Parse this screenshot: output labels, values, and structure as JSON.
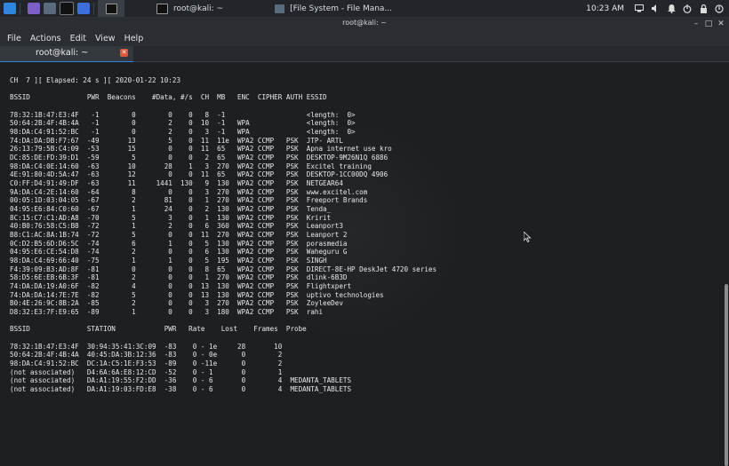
{
  "taskbar": {
    "tasks": [
      {
        "label": "root@kali: ~"
      },
      {
        "label": "[File System - File Mana..."
      }
    ],
    "clock": "10:23 AM"
  },
  "window": {
    "title": "root@kali: ~",
    "controls": [
      "–",
      "□",
      "✕"
    ]
  },
  "menu": [
    "File",
    "Actions",
    "Edit",
    "View",
    "Help"
  ],
  "tab": {
    "label": "root@kali: ~"
  },
  "terminal": {
    "lines": [
      "CH  7 ][ Elapsed: 24 s ][ 2020-01-22 10:23",
      "",
      "BSSID              PWR  Beacons    #Data, #/s  CH  MB   ENC  CIPHER AUTH ESSID",
      "",
      "78:32:1B:47:E3:4F   -1        0        0    0   8  -1                    <length:  0>",
      "50:64:2B:4F:4B:4A   -1        0        2    0  10  -1   WPA              <length:  0>",
      "98:DA:C4:91:52:BC   -1        0        2    0   3  -1   WPA              <length:  0>",
      "74:DA:DA:DB:F7:67  -49       13        5    0  11  11e  WPA2 CCMP   PSK  JTP- ARTL",
      "26:13:79:5B:C4:09  -53       15        0    0  11  65   WPA2 CCMP   PSK  Apna internet use kro",
      "DC:85:DE:FD:39:D1  -59        5        0    0   2  65   WPA2 CCMP   PSK  DESKTOP-9M26N1Q 6886",
      "98:DA:C4:0E:14:60  -63       10       28    1   3  270  WPA2 CCMP   PSK  Excitel training",
      "4E:91:80:4D:5A:47  -63       12        0    0  11  65   WPA2 CCMP   PSK  DESKTOP-1CC00DQ 4906",
      "C0:FF:D4:91:49:DF  -63       11     1441  130   9  130  WPA2 CCMP   PSK  NETGEAR64",
      "9A:DA:C4:2E:14:60  -64        8        0    0   3  270  WPA2 CCMP   PSK  www.excitel.com",
      "00:05:1D:03:04:05  -67        2       81    0   1  270  WPA2 CCMP   PSK  Freeport Brands",
      "04:95:E6:84:C0:60  -67        1       24    0   2  130  WPA2 CCMP   PSK  Tenda_",
      "8C:15:C7:C1:AD:A8  -70        5        3    0   1  130  WPA2 CCMP   PSK  Kririt",
      "40:B0:76:58:C5:B8  -72        1        2    0   6  360  WPA2 CCMP   PSK  Leanport3",
      "B8:C1:AC:8A:1B:74  -72        5        0    0  11  270  WPA2 CCMP   PSK  Leanport 2",
      "0C:D2:B5:6D:D6:5C  -74        6        1    0   5  130  WPA2 CCMP   PSK  porasmedia",
      "04:95:E6:CE:54:D8  -74        2        0    0   6  130  WPA2 CCMP   PSK  Waheguru G",
      "98:DA:C4:69:66:40  -75        1        1    0   5  195  WPA2 CCMP   PSK  SINGH",
      "F4:39:09:B3:AD:8F  -81        0        0    0   8  65   WPA2 CCMP   PSK  DIRECT-8E-HP DeskJet 4720 series",
      "58:D5:6E:EB:6B:3F  -81        2        0    0   1  270  WPA2 CCMP   PSK  dlink-6B3D",
      "74:DA:DA:19:A0:6F  -82        4        0    0  13  130  WPA2 CCMP   PSK  Flightxpert",
      "74:DA:DA:14:7E:7E  -82        5        0    0  13  130  WPA2 CCMP   PSK  uptivo technologies",
      "B0:4E:26:9C:8B:2A  -85        2        0    0   3  270  WPA2 CCMP   PSK  ZoyleeDev",
      "D8:32:E3:7F:E9:65  -89        1        0    0   3  180  WPA2 CCMP   PSK  rahi",
      "",
      "BSSID              STATION            PWR   Rate    Lost    Frames  Probe",
      "",
      "78:32:1B:47:E3:4F  30:94:35:41:3C:09  -83    0 - 1e     28       10",
      "50:64:2B:4F:4B:4A  40:45:DA:3B:12:36  -83    0 - 0e      0        2",
      "98:DA:C4:91:52:BC  DC:1A:C5:1E:F3:53  -89    0 -11e      0        2",
      "(not associated)   D4:6A:6A:E8:12:CD  -52    0 - 1       0        1",
      "(not associated)   DA:A1:19:55:F2:DD  -36    0 - 6       0        4  MEDANTA_TABLETS",
      "(not associated)   DA:A1:19:03:FD:E8  -38    0 - 6       0        4  MEDANTA_TABLETS"
    ]
  }
}
